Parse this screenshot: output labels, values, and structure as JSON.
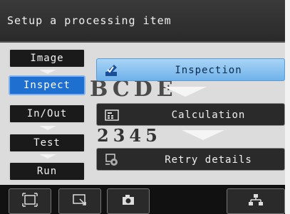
{
  "header": {
    "title": "Setup a processing item"
  },
  "nav": {
    "items": [
      {
        "label": "Image"
      },
      {
        "label": "Inspect"
      },
      {
        "label": "In/Out"
      },
      {
        "label": "Test"
      },
      {
        "label": "Run"
      }
    ],
    "active": "Inspect"
  },
  "background": {
    "text1": "BCDE",
    "text2": "2345"
  },
  "menu": {
    "items": [
      {
        "label": "Inspection",
        "icon": "pencil-check-icon"
      },
      {
        "label": "Calculation",
        "icon": "calculator-icon"
      },
      {
        "label": "Retry details",
        "icon": "retry-gear-icon"
      }
    ],
    "selected": "Inspection"
  },
  "toolbar": {
    "buttons": [
      {
        "icon": "frame-icon"
      },
      {
        "icon": "zoom-select-icon"
      },
      {
        "icon": "camera-icon"
      },
      {
        "icon": "network-icon"
      }
    ]
  },
  "colors": {
    "accent": "#1e6fd0",
    "selected": "#8cc4f0"
  }
}
